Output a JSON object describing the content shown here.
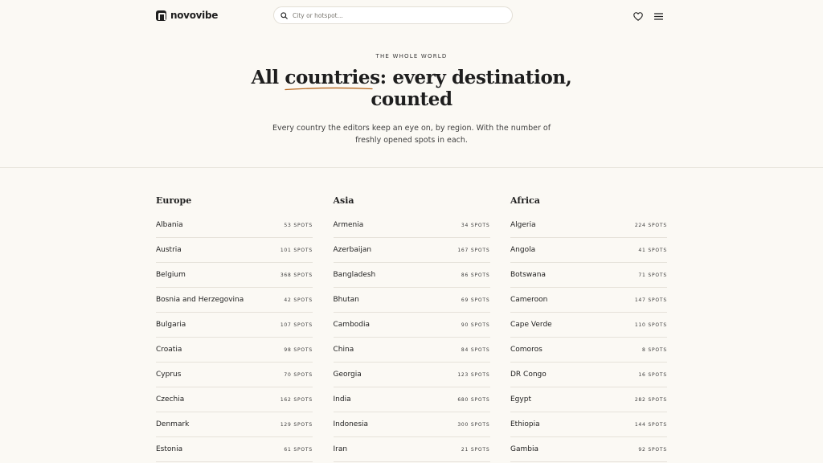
{
  "brand": {
    "name": "novovibe"
  },
  "search": {
    "placeholder": "City or hotspot..."
  },
  "hero": {
    "eyebrow": "THE WHOLE WORLD",
    "headline_bold_1": "All",
    "headline_bold_2": "countries",
    "headline_rest_1": ": every destination,",
    "headline_rest_2": "counted",
    "lede": "Every country the editors keep an eye on, by region. With the number of freshly opened spots in each."
  },
  "regions": [
    {
      "title": "Europe",
      "countries": [
        {
          "name": "Albania",
          "count": "53 SPOTS"
        },
        {
          "name": "Austria",
          "count": "101 SPOTS"
        },
        {
          "name": "Belgium",
          "count": "368 SPOTS"
        },
        {
          "name": "Bosnia and Herzegovina",
          "count": "42 SPOTS"
        },
        {
          "name": "Bulgaria",
          "count": "107 SPOTS"
        },
        {
          "name": "Croatia",
          "count": "98 SPOTS"
        },
        {
          "name": "Cyprus",
          "count": "70 SPOTS"
        },
        {
          "name": "Czechia",
          "count": "162 SPOTS"
        },
        {
          "name": "Denmark",
          "count": "129 SPOTS"
        },
        {
          "name": "Estonia",
          "count": "61 SPOTS"
        }
      ]
    },
    {
      "title": "Asia",
      "countries": [
        {
          "name": "Armenia",
          "count": "34 SPOTS"
        },
        {
          "name": "Azerbaijan",
          "count": "167 SPOTS"
        },
        {
          "name": "Bangladesh",
          "count": "86 SPOTS"
        },
        {
          "name": "Bhutan",
          "count": "69 SPOTS"
        },
        {
          "name": "Cambodia",
          "count": "90 SPOTS"
        },
        {
          "name": "China",
          "count": "84 SPOTS"
        },
        {
          "name": "Georgia",
          "count": "123 SPOTS"
        },
        {
          "name": "India",
          "count": "680 SPOTS"
        },
        {
          "name": "Indonesia",
          "count": "300 SPOTS"
        },
        {
          "name": "Iran",
          "count": "21 SPOTS"
        }
      ]
    },
    {
      "title": "Africa",
      "countries": [
        {
          "name": "Algeria",
          "count": "224 SPOTS"
        },
        {
          "name": "Angola",
          "count": "41 SPOTS"
        },
        {
          "name": "Botswana",
          "count": "71 SPOTS"
        },
        {
          "name": "Cameroon",
          "count": "147 SPOTS"
        },
        {
          "name": "Cape Verde",
          "count": "110 SPOTS"
        },
        {
          "name": "Comoros",
          "count": "8 SPOTS"
        },
        {
          "name": "DR Congo",
          "count": "16 SPOTS"
        },
        {
          "name": "Egypt",
          "count": "282 SPOTS"
        },
        {
          "name": "Ethiopia",
          "count": "144 SPOTS"
        },
        {
          "name": "Gambia",
          "count": "92 SPOTS"
        }
      ]
    }
  ],
  "colors": {
    "background": "#fbf9f4",
    "ink": "#1e1e1e",
    "accent": "#b5651d"
  }
}
